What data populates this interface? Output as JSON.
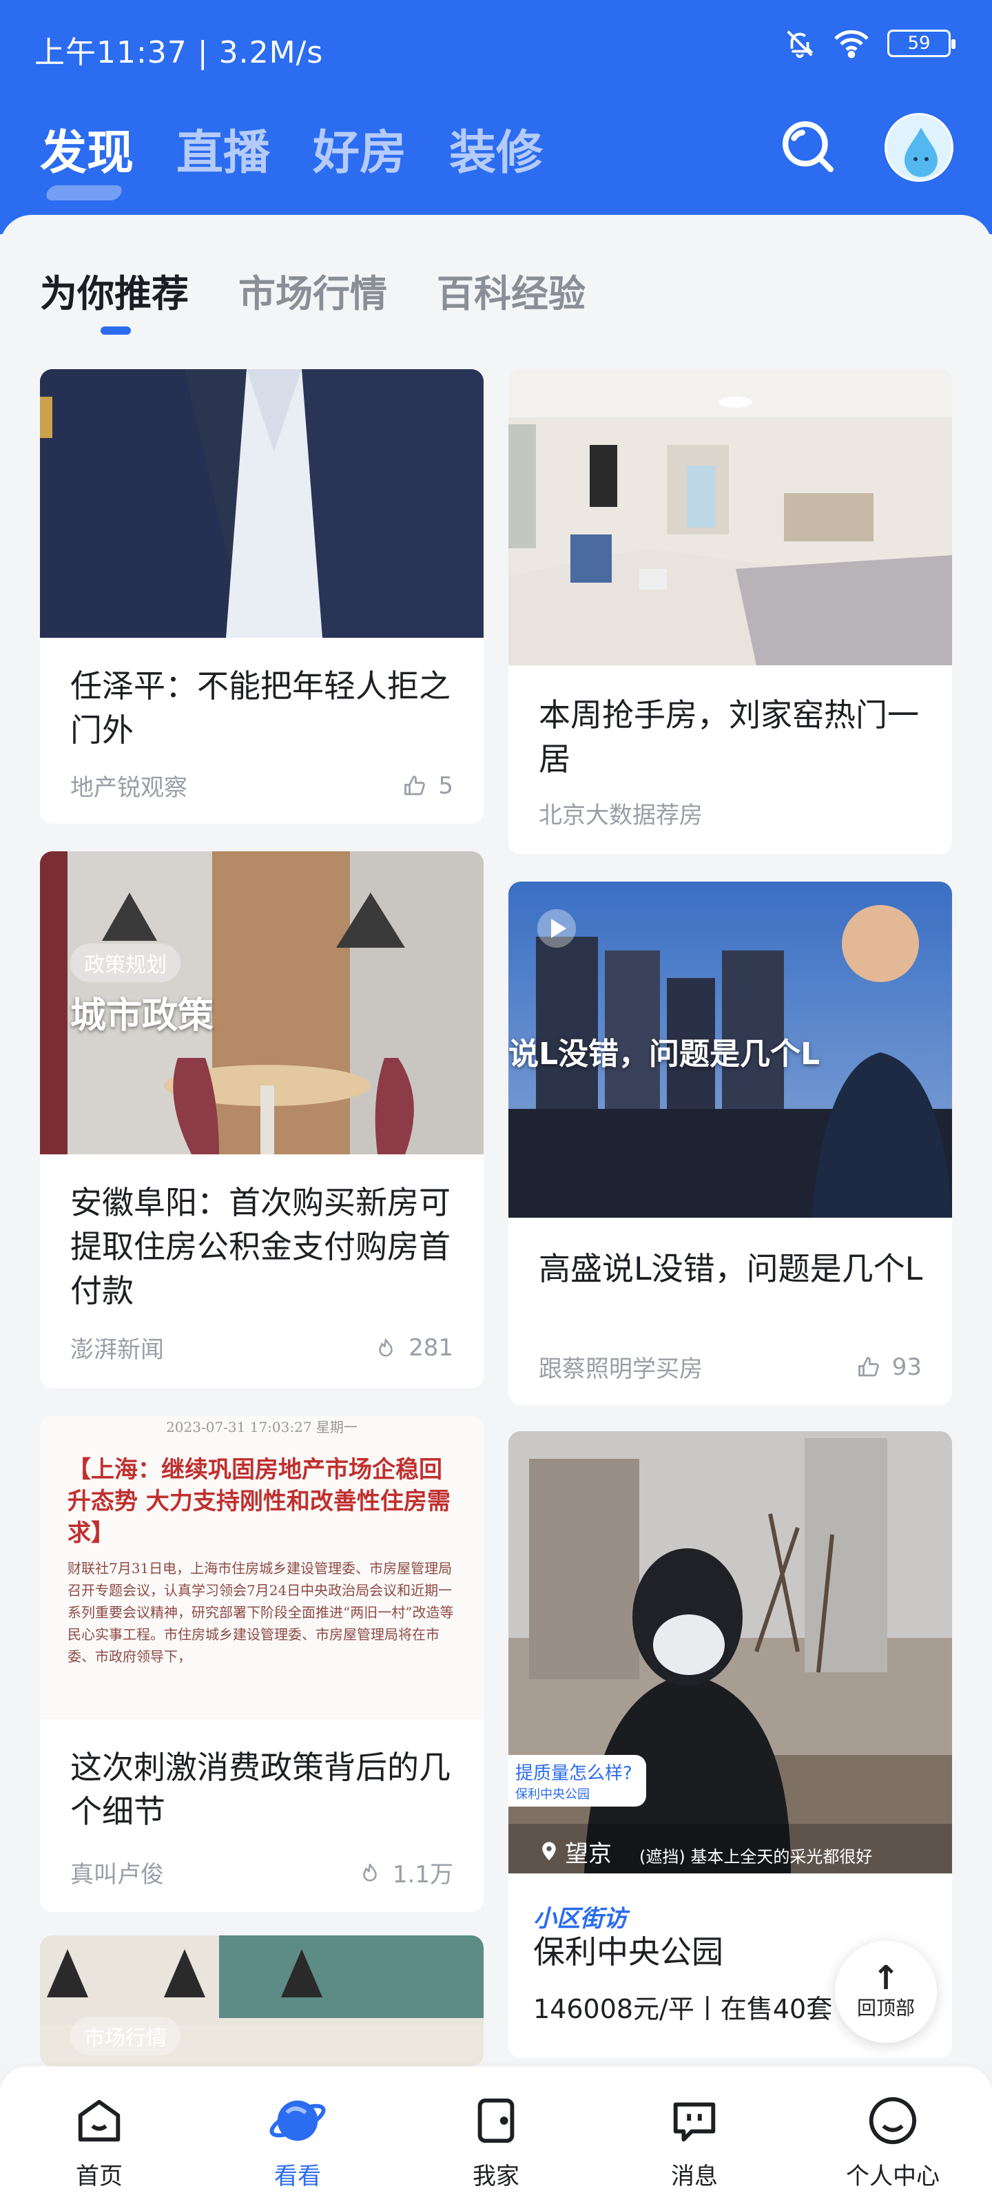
{
  "status_bar": {
    "time_speed": "上午11:37 | 3.2M/s",
    "battery": "59"
  },
  "main_nav": [
    "发现",
    "直播",
    "好房",
    "装修"
  ],
  "sub_tabs": [
    "为你推荐",
    "市场行情",
    "百科经验"
  ],
  "cards": [
    {
      "title": "任泽平：不能把年轻人拒之门外",
      "source": "地产锐观察",
      "likes": "5"
    },
    {
      "title": "本周抢手房，刘家窑热门一居",
      "source": "北京大数据荐房"
    },
    {
      "tag": "政策规划",
      "overlay": "城市政策",
      "title": "安徽阜阳：首次购买新房可提取住房公积金支付购房首付款",
      "source": "澎湃新闻",
      "likes": "281"
    },
    {
      "overlay": "说L没错，问题是几个L",
      "title": "高盛说L没错，问题是几个L",
      "source": "跟蔡照明学买房",
      "likes": "93"
    },
    {
      "doc_date": "2023-07-31 17:03:27 星期一",
      "doc_head": "【上海：继续巩固房地产市场企稳回升态势 大力支持刚性和改善性住房需求】",
      "doc_body": "财联社7月31日电，上海市住房城乡建设管理委、市房屋管理局召开专题会议，认真学习领会7月24日中央政治局会议和近期一系列重要会议精神，研究部署下阶段全面推进“两旧一村”改造等民心实事工程。市住房城乡建设管理委、市房屋管理局将在市委、市政府领导下，",
      "title": "这次刺激消费政策背后的几个细节",
      "source": "真叫卢俊",
      "likes": "1.1万"
    },
    {
      "bubble_q": "提质量怎么样?",
      "bubble_sub": "保利中央公园",
      "location": "望京",
      "caption": "(遮挡) 基本上全天的采光都很好",
      "logo": "小区街访",
      "title": "保利中央公园",
      "price": "146008元/平丨在售40套"
    },
    {
      "tag": "市场行情"
    }
  ],
  "back_to_top": "回顶部",
  "bottom_nav": [
    "首页",
    "看看",
    "我家",
    "消息",
    "个人中心"
  ],
  "colors": {
    "brand": "#2b6cf0",
    "background": "#f4f5f7"
  }
}
